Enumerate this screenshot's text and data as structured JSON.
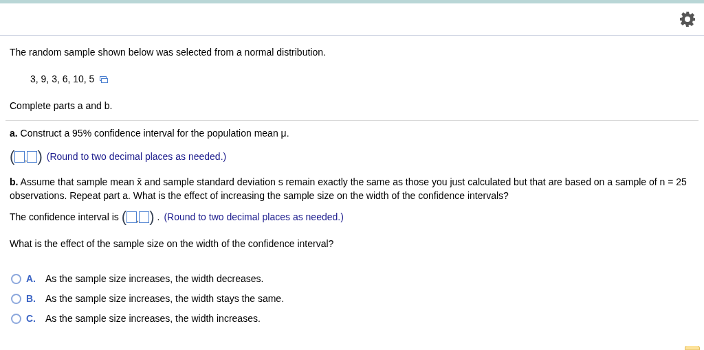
{
  "intro": "The random sample shown below was selected from a normal distribution.",
  "sample": "3, 9, 3, 6, 10, 5",
  "instruction": "Complete parts a and b.",
  "part_a": {
    "question": "**a.** Construct a 95% confidence interval for the population mean μ.",
    "interval": {
      "open": "(",
      "separator": ",",
      "close": ")"
    },
    "hint": "(Round to two decimal places as needed.)"
  },
  "part_b": {
    "question": "**b.** Assume that sample mean x̄ and sample standard deviation s remain exactly the same as those you just calculated but that are based on a sample of n = 25 observations. Repeat part a. What is the effect of increasing the sample size on the width of the confidence intervals?",
    "prompt": "The confidence interval is",
    "interval": {
      "open": "(",
      "separator": ",",
      "close": ")"
    },
    "after": ".",
    "hint": "(Round to two decimal places as needed.)",
    "question2": "What is the effect of the sample size on the width of the confidence interval?"
  },
  "options": [
    {
      "letter": "A.",
      "text": "As the sample size increases, the width decreases.",
      "selected": false
    },
    {
      "letter": "B.",
      "text": "As the sample size increases, the width stays the same.",
      "selected": false
    },
    {
      "letter": "C.",
      "text": "As the sample size increases, the width increases.",
      "selected": false
    }
  ]
}
